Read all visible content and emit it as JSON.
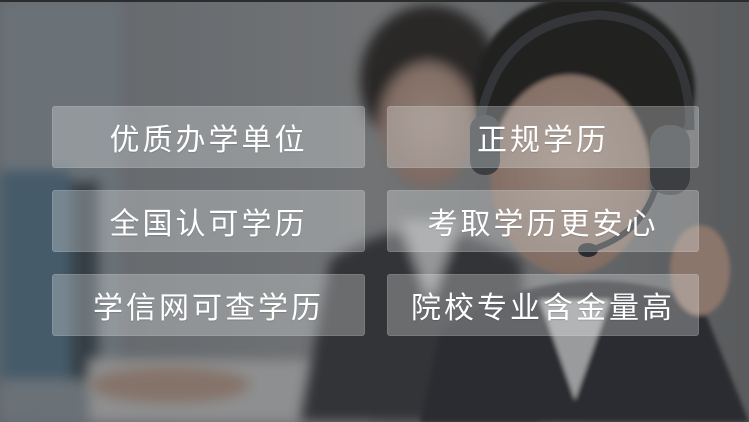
{
  "features": [
    {
      "label": "优质办学单位"
    },
    {
      "label": "正规学历"
    },
    {
      "label": "全国认可学历"
    },
    {
      "label": "考取学历更安心"
    },
    {
      "label": "学信网可查学历"
    },
    {
      "label": "院校专业含金量高"
    }
  ],
  "background": {
    "subject": "customer-service-agents-with-headset",
    "overlay_color": "#2c3034"
  }
}
